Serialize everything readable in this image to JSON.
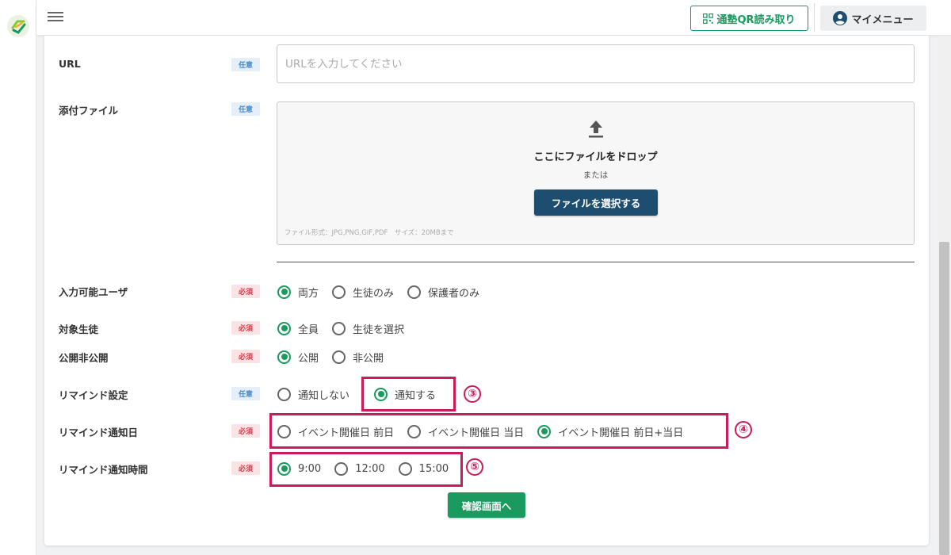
{
  "header": {
    "qr_button": "通塾QR読み取り",
    "menu_button": "マイメニュー"
  },
  "form": {
    "url": {
      "label": "URL",
      "badge": "任意",
      "placeholder": "URLを入力してください",
      "value": ""
    },
    "attachment": {
      "label": "添付ファイル",
      "badge": "任意",
      "drop_title": "ここにファイルをドロップ",
      "or_text": "または",
      "select_button": "ファイルを選択する",
      "hint": "ファイル形式：JPG,PNG,GIF,PDF　サイズ：20MBまで"
    },
    "input_users": {
      "label": "入力可能ユーザ",
      "badge": "必須",
      "options": [
        {
          "label": "両方",
          "selected": true
        },
        {
          "label": "生徒のみ",
          "selected": false
        },
        {
          "label": "保護者のみ",
          "selected": false
        }
      ]
    },
    "target_students": {
      "label": "対象生徒",
      "badge": "必須",
      "options": [
        {
          "label": "全員",
          "selected": true
        },
        {
          "label": "生徒を選択",
          "selected": false
        }
      ]
    },
    "visibility": {
      "label": "公開非公開",
      "badge": "必須",
      "options": [
        {
          "label": "公開",
          "selected": true
        },
        {
          "label": "非公開",
          "selected": false
        }
      ]
    },
    "remind_setting": {
      "label": "リマインド設定",
      "badge": "任意",
      "options": [
        {
          "label": "通知しない",
          "selected": false
        },
        {
          "label": "通知する",
          "selected": true
        }
      ]
    },
    "remind_day": {
      "label": "リマインド通知日",
      "badge": "必須",
      "options": [
        {
          "label": "イベント開催日 前日",
          "selected": false
        },
        {
          "label": "イベント開催日 当日",
          "selected": false
        },
        {
          "label": "イベント開催日 前日+当日",
          "selected": true
        }
      ]
    },
    "remind_time": {
      "label": "リマインド通知時間",
      "badge": "必須",
      "options": [
        {
          "label": "9:00",
          "selected": true
        },
        {
          "label": "12:00",
          "selected": false
        },
        {
          "label": "15:00",
          "selected": false
        }
      ]
    },
    "confirm_button": "確認画面へ"
  },
  "annotations": [
    "③",
    "④",
    "⑤"
  ],
  "colors": {
    "accent": "#1a9a5e",
    "primary_dark": "#1d4e6f",
    "highlight": "#cc1b5b"
  }
}
